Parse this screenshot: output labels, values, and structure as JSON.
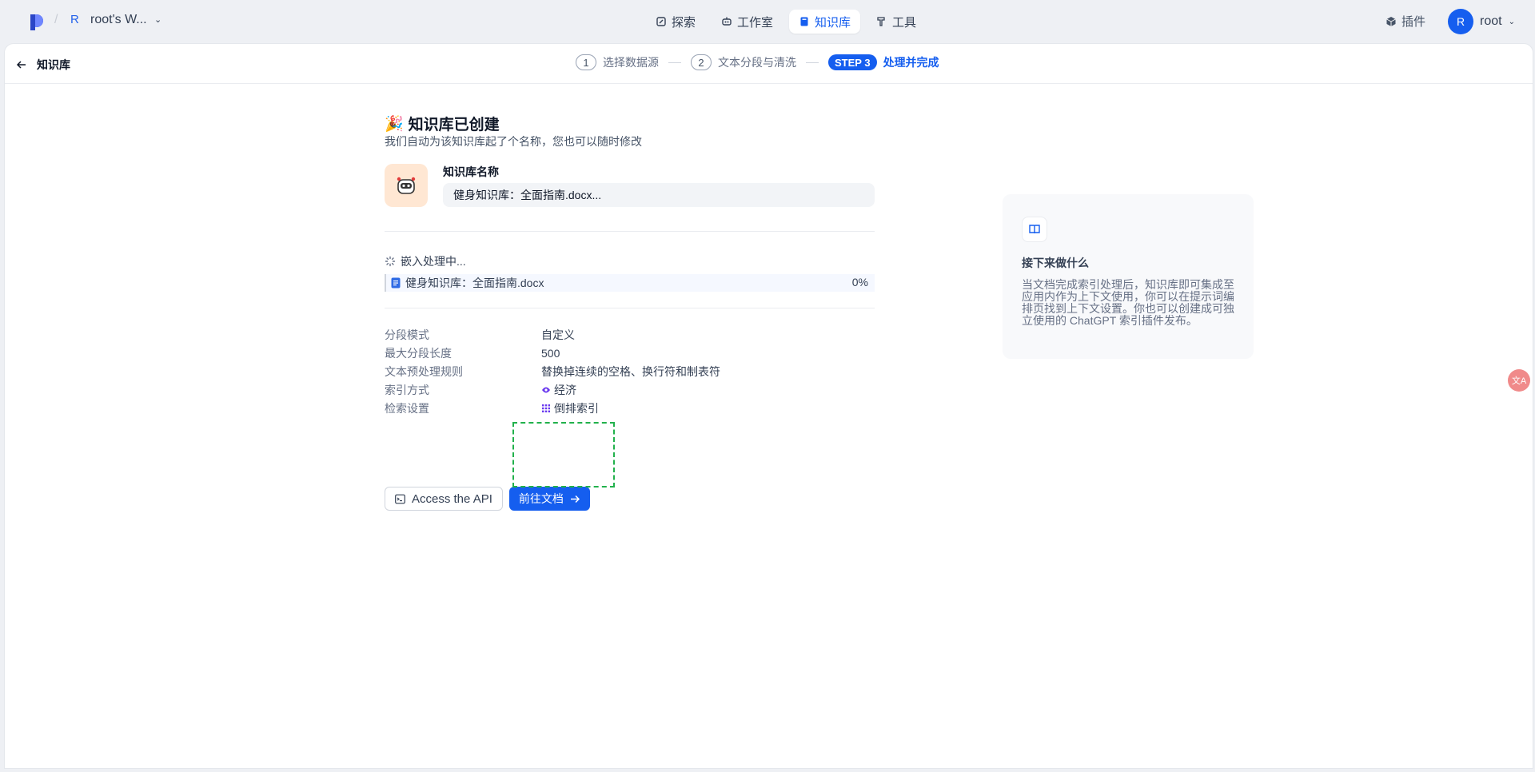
{
  "header": {
    "workspace_initial": "R",
    "workspace_name": "root's W...",
    "nav": [
      {
        "label": "探索",
        "icon": "explore-icon"
      },
      {
        "label": "工作室",
        "icon": "robot-icon"
      },
      {
        "label": "知识库",
        "icon": "book-icon",
        "active": true
      },
      {
        "label": "工具",
        "icon": "hammer-icon"
      }
    ],
    "plugin_label": "插件",
    "user_initial": "R",
    "user_name": "root"
  },
  "stepbar": {
    "back_label": "知识库",
    "step1_num": "1",
    "step1_label": "选择数据源",
    "step2_num": "2",
    "step2_label": "文本分段与清洗",
    "step3_tag": "STEP 3",
    "step3_label": "处理并完成"
  },
  "main": {
    "title": "知识库已创建",
    "subtitle": "我们自动为该知识库起了个名称，您也可以随时修改",
    "name_label": "知识库名称",
    "name_value": "健身知识库：全面指南.docx...",
    "embed_status": "嵌入处理中...",
    "doc_name": "健身知识库：全面指南.docx",
    "doc_progress": "0%",
    "meta": [
      {
        "key": "分段模式",
        "value": "自定义"
      },
      {
        "key": "最大分段长度",
        "value": "500"
      },
      {
        "key": "文本预处理规则",
        "value": "替换掉连续的空格、换行符和制表符"
      },
      {
        "key": "索引方式",
        "value": "经济"
      },
      {
        "key": "检索设置",
        "value": "倒排索引"
      }
    ],
    "api_button": "Access the API",
    "go_button": "前往文档"
  },
  "side": {
    "title": "接下来做什么",
    "text": "当文档完成索引处理后，知识库即可集成至应用内作为上下文使用，你可以在提示词编排页找到上下文设置。你也可以创建成可独立使用的 ChatGPT 索引插件发布。"
  },
  "floater_label": "文A",
  "colors": {
    "accent": "#155eef",
    "highlight": "#22b14c"
  }
}
